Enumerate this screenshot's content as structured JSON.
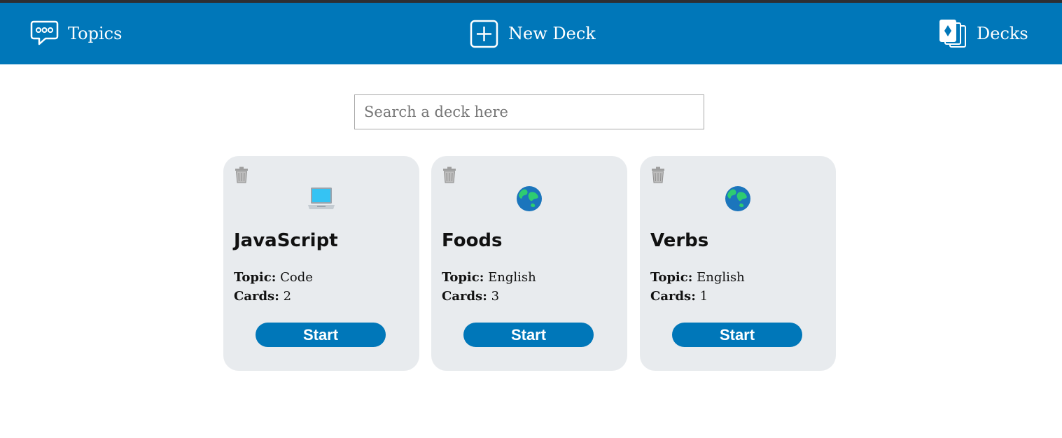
{
  "nav": {
    "topics_label": "Topics",
    "new_deck_label": "New Deck",
    "decks_label": "Decks",
    "bar_color": "#0077b9",
    "topics_icon": "chat-bubble-icon",
    "new_deck_icon": "plus-square-icon",
    "decks_icon": "cards-icon"
  },
  "search": {
    "placeholder": "Search a deck here",
    "value": ""
  },
  "decks": [
    {
      "emoji": "💻",
      "icon": "laptop-icon",
      "title": "JavaScript",
      "topic_label": "Topic:",
      "topic": "Code",
      "cards_label": "Cards:",
      "cards": "2",
      "start_label": "Start"
    },
    {
      "emoji": "🌏",
      "icon": "globe-icon",
      "title": "Foods",
      "topic_label": "Topic:",
      "topic": "English",
      "cards_label": "Cards:",
      "cards": "3",
      "start_label": "Start"
    },
    {
      "emoji": "🌏",
      "icon": "globe-icon",
      "title": "Verbs",
      "topic_label": "Topic:",
      "topic": "English",
      "cards_label": "Cards:",
      "cards": "1",
      "start_label": "Start"
    }
  ]
}
